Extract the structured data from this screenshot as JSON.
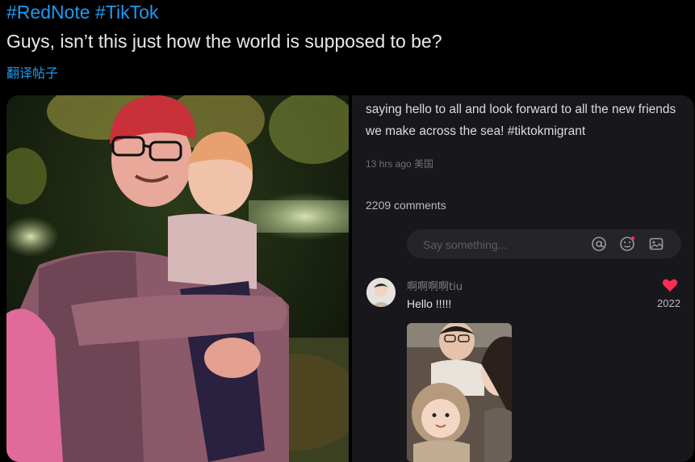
{
  "tweet": {
    "hashtags": [
      "#RedNote",
      "#TikTok"
    ],
    "text": "Guys, isn’t this just how the world is supposed to be?",
    "translate_label": "翻译帖子"
  },
  "screenshot": {
    "post_text_cut": "…",
    "post_text": "saying hello to all and look forward to all the new friends we make across the sea!  #tiktokmigrant",
    "post_meta": "13 hrs ago 美国",
    "comments_count": "2209 comments",
    "comment_input_placeholder": "Say something...",
    "comment": {
      "author": "啊啊啊啊tiu",
      "text": "Hello !!!!!",
      "likes": "2022"
    }
  },
  "colors": {
    "link": "#1d9bf0",
    "like_heart": "#fe2c55",
    "app_background": "#18181c"
  }
}
